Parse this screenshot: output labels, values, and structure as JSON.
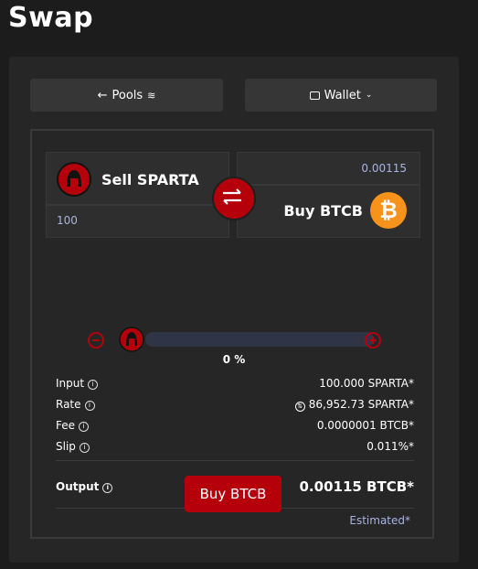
{
  "page_title": "Swap",
  "nav": {
    "pools_label": "Pools",
    "wallet_label": "Wallet"
  },
  "sell": {
    "label": "Sell SPARTA",
    "amount": "100"
  },
  "buy": {
    "label": "Buy BTCB",
    "amount": "0.00115"
  },
  "slider": {
    "value_label": "0 %",
    "fraction": 0
  },
  "details": {
    "input_label": "Input",
    "input_value": "100.000 SPARTA*",
    "rate_label": "Rate",
    "rate_value": "86,952.73 SPARTA*",
    "fee_label": "Fee",
    "fee_value": "0.0000001 BTCB*",
    "slip_label": "Slip",
    "slip_value": "0.011%*",
    "output_label": "Output",
    "output_value": "0.00115 BTCB*",
    "estimated": "Estimated*"
  },
  "action": {
    "buy_button": "Buy BTCB"
  },
  "colors": {
    "accent": "#b5000c",
    "bitcoin": "#f7931a",
    "amount_text": "#a8b3e0"
  }
}
